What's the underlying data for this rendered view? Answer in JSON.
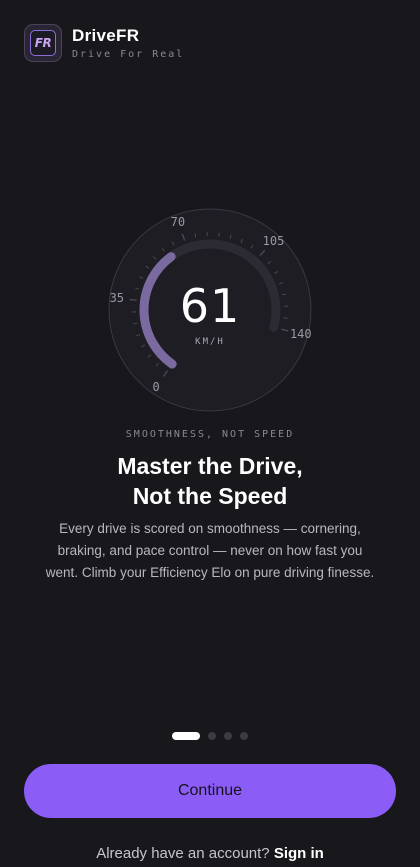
{
  "header": {
    "logo_text": "FR",
    "app_name": "DriveFR",
    "tagline": "Drive For Real"
  },
  "gauge": {
    "value": "61",
    "unit": "KM/H",
    "ticks": [
      "0",
      "35",
      "70",
      "105",
      "140"
    ],
    "min": 0,
    "max": 140,
    "current": 61,
    "colors": {
      "track": "#2c2a33",
      "fill": "#7b6aa0",
      "ring": "#3a3842"
    }
  },
  "content": {
    "eyebrow": "SMOOTHNESS, NOT SPEED",
    "headline_line1": "Master the Drive,",
    "headline_line2": "Not the Speed",
    "body": "Every drive is scored on smoothness — cornering, braking, and pace control — never on how fast you went. Climb your Efficiency Elo on pure driving finesse."
  },
  "pager": {
    "total": 4,
    "active": 1
  },
  "actions": {
    "continue_label": "Continue",
    "signin_prompt": "Already have an account?",
    "signin_link": "Sign in"
  },
  "colors": {
    "background": "#18171c",
    "accent": "#8b5cf6"
  }
}
